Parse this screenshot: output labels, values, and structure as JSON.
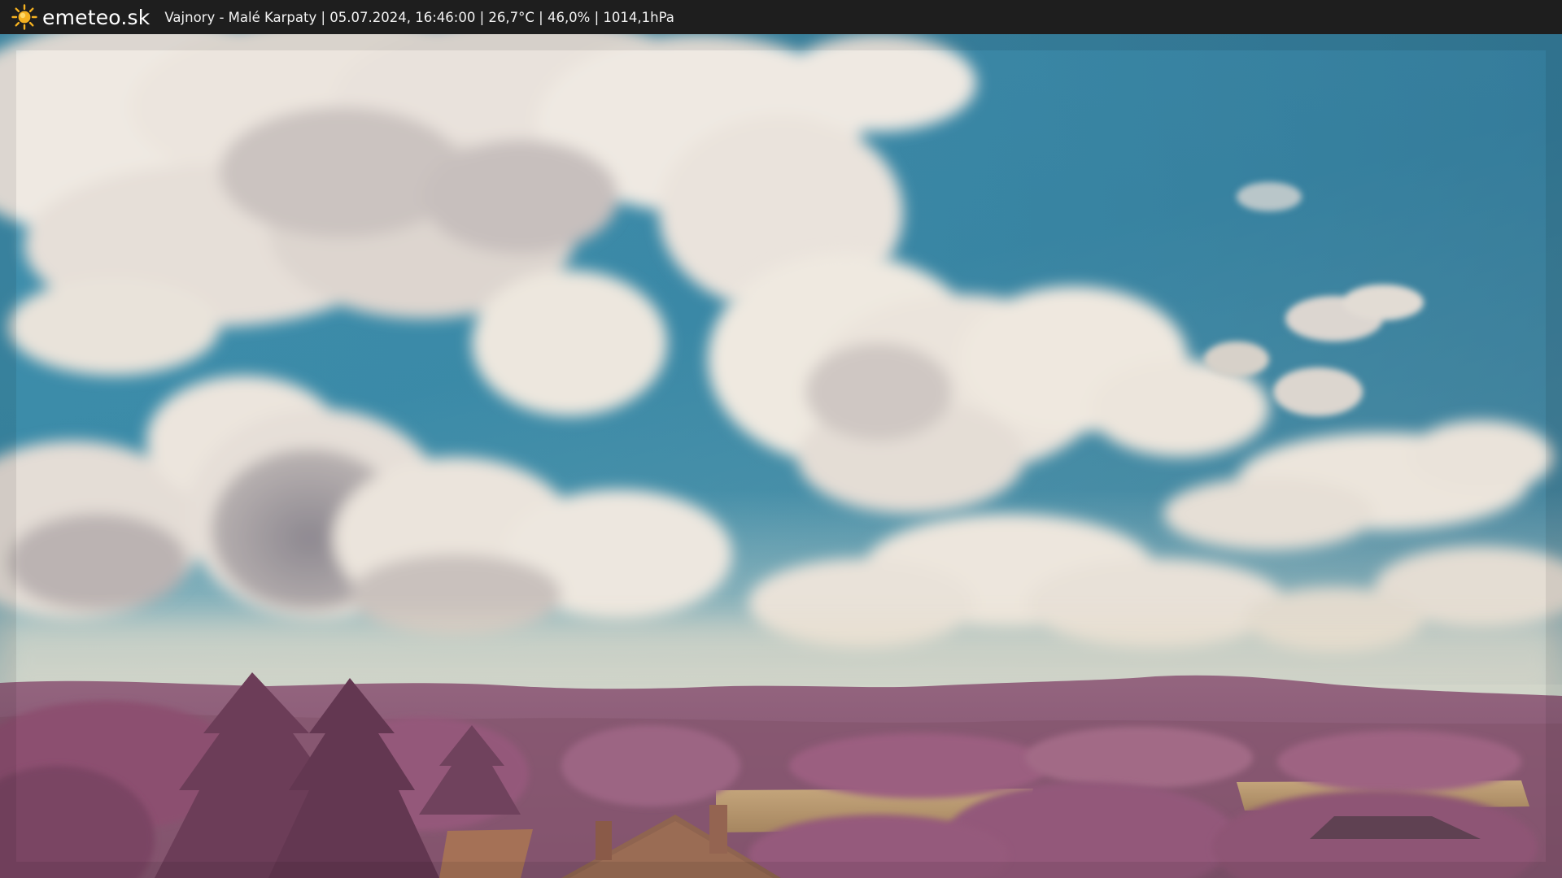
{
  "header": {
    "brand": "emeteo.sk",
    "caption": "Vajnory - Malé Karpaty | 05.07.2024, 16:46:00 | 26,7°C | 46,0% | 1014,1hPa"
  },
  "icons": {
    "brand_icon": "sun-icon"
  },
  "colors": {
    "sky": "#3a8aa8",
    "clouds": "#ece6de",
    "hills": "#8a5a7c",
    "foliage": "#9a5f7e",
    "fields": "#b89870",
    "roof": "#9a6a4e",
    "sun": "#f5b120"
  }
}
